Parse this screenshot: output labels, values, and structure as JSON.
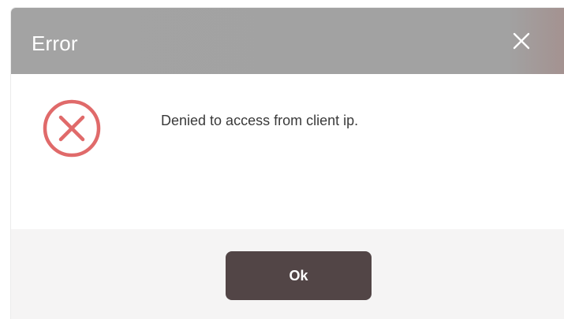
{
  "dialog": {
    "title": "Error",
    "close_icon": "close-icon",
    "status_icon": "error-circle-x-icon",
    "message": "Denied to access from client ip.",
    "ok_label": "Ok"
  },
  "colors": {
    "titlebar": "#a3a3a3",
    "error_icon": "#e06a6a",
    "button": "#524546",
    "footer": "#f5f4f4"
  }
}
